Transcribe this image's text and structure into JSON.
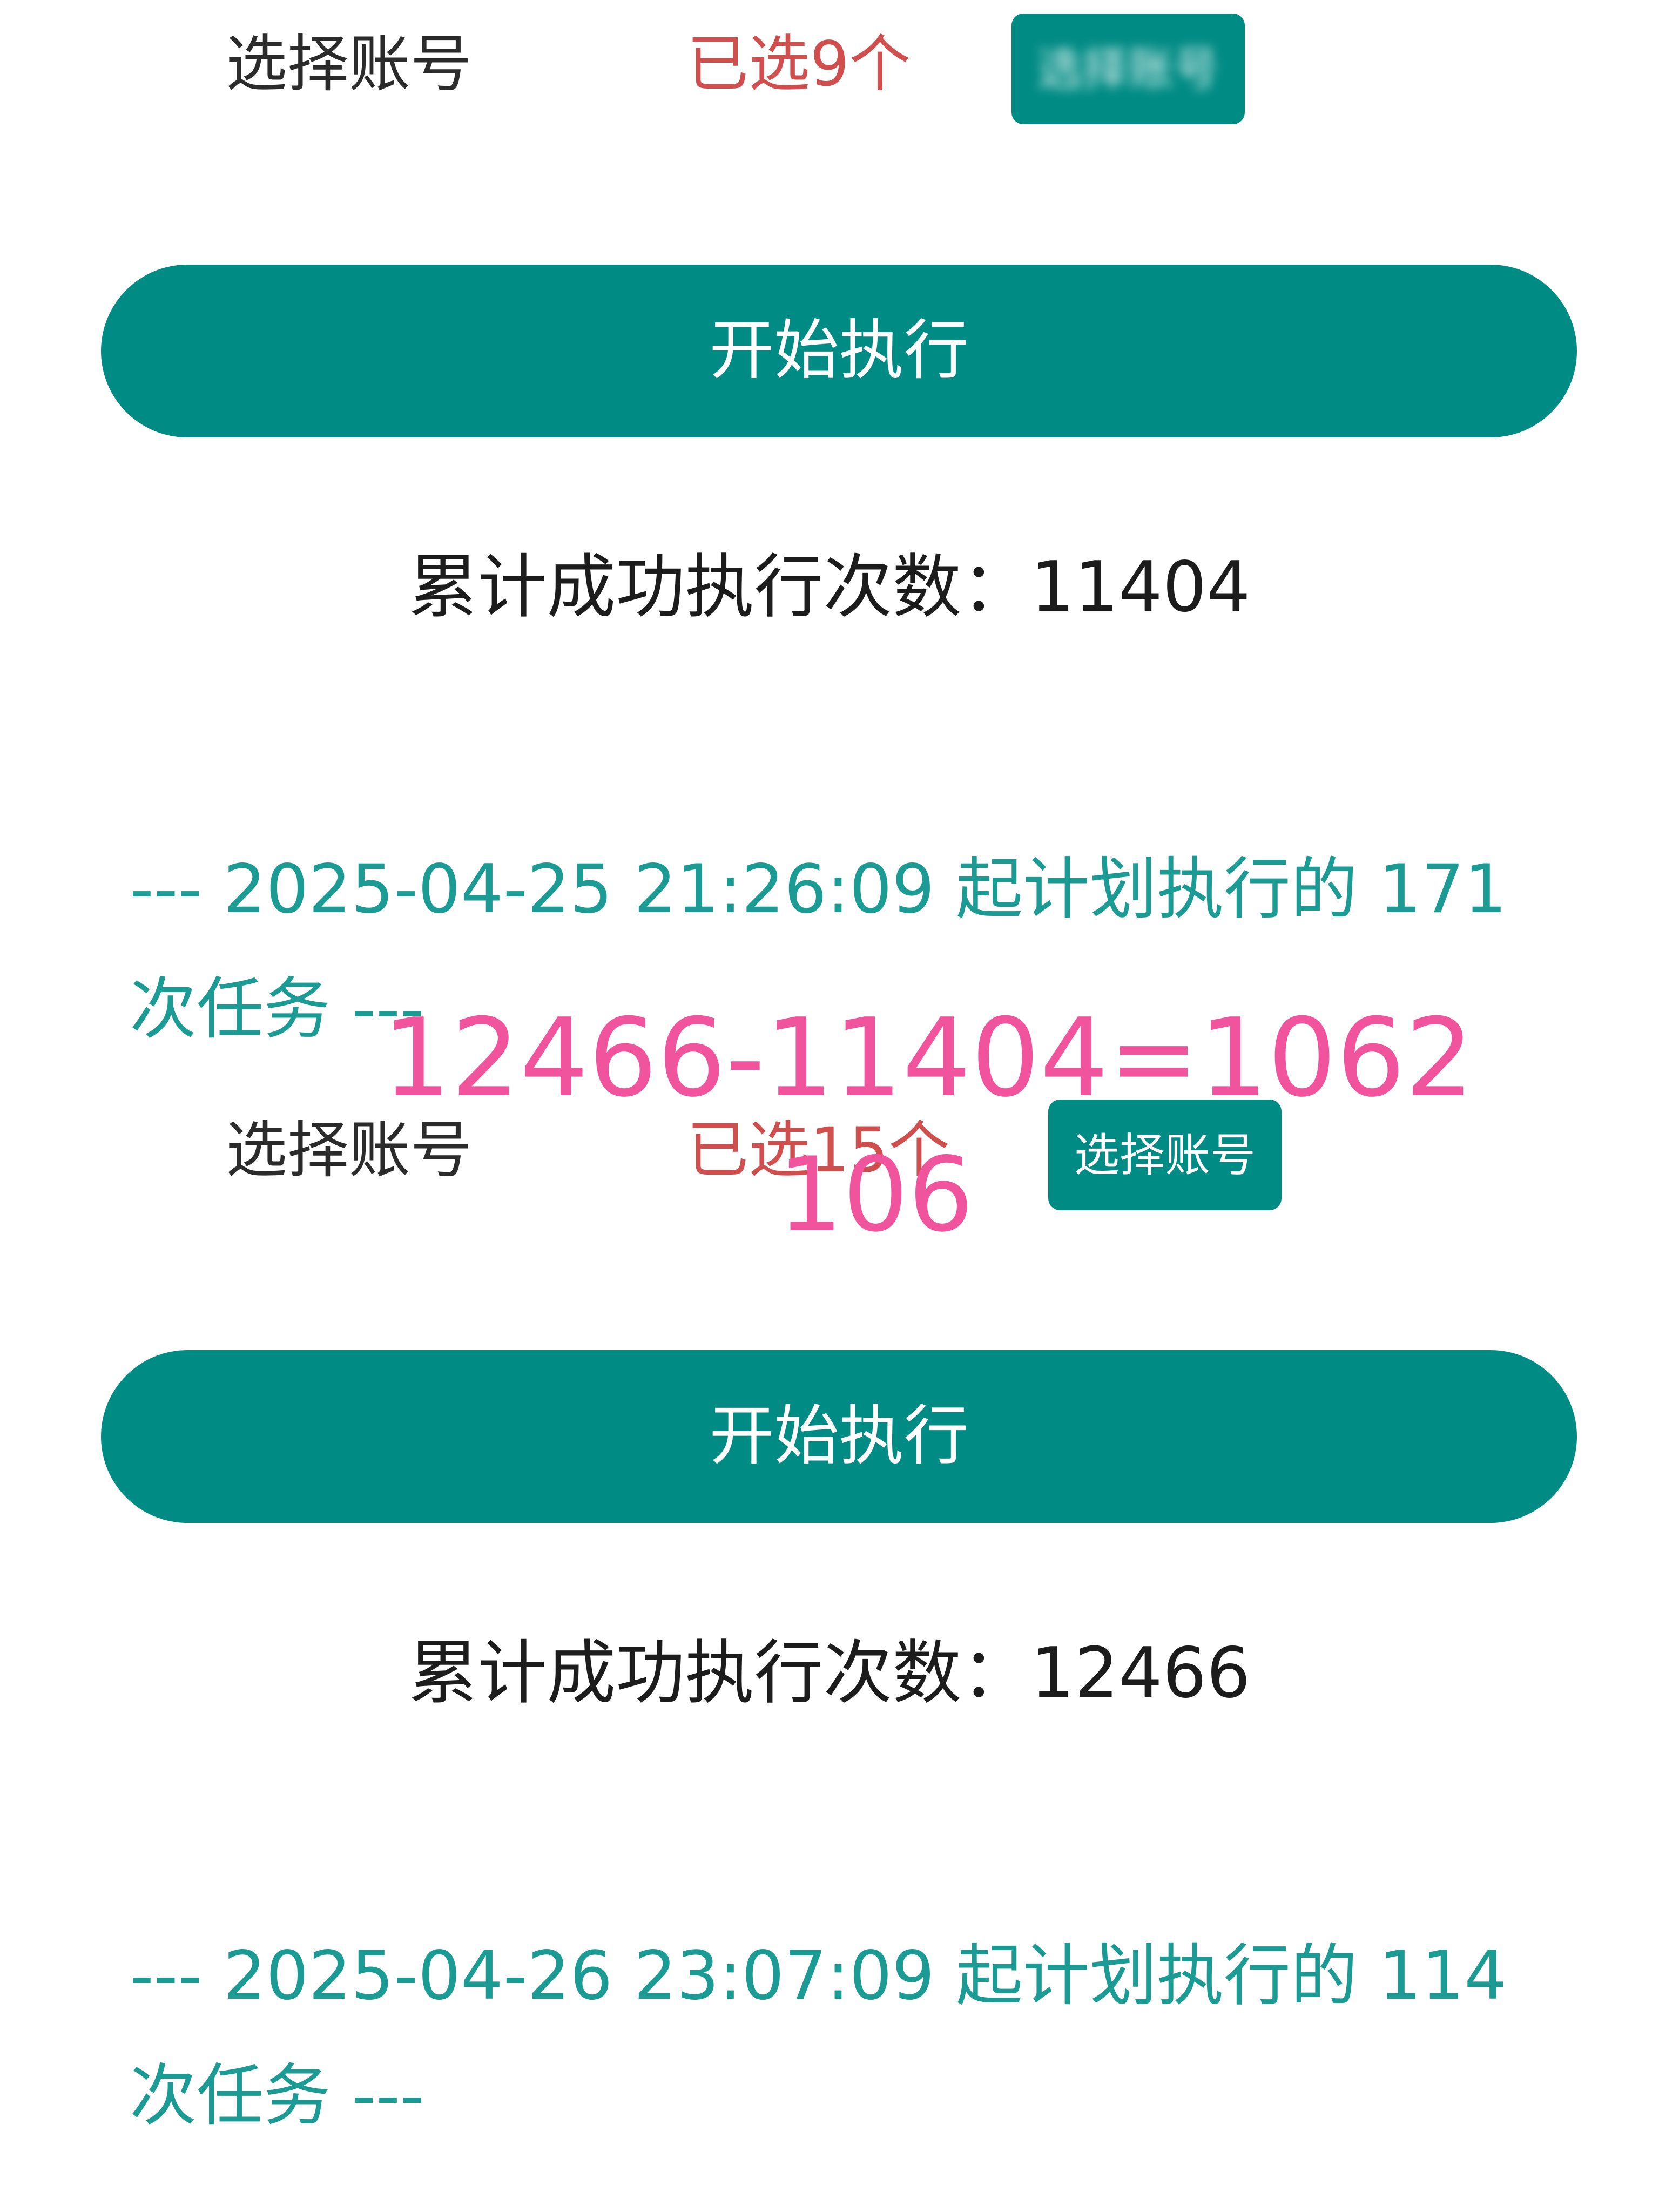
{
  "colors": {
    "primary": "#008b84",
    "selected_red": "#cf4f4f",
    "log_teal": "#1b9b93",
    "overlay_pink": "#f0549c"
  },
  "sections": [
    {
      "account_label": "选择账号",
      "selected_text": "已选9个",
      "select_button": "选择账号",
      "start_button": "开始执行",
      "count_text": "累计成功执行次数：11404",
      "log_line1": "--- 2025-04-25 21:26:09 起计划执行的 171",
      "log_line2": "次任务 ---"
    },
    {
      "account_label": "选择账号",
      "selected_text": "已选15个",
      "select_button": "选择账号",
      "start_button": "开始执行",
      "count_text": "累计成功执行次数：12466",
      "log_line1": "--- 2025-04-26 23:07:09 起计划执行的 114",
      "log_line2": "次任务 ---"
    }
  ],
  "annotation": {
    "equation": "12466-11404=1062",
    "result": "106"
  }
}
